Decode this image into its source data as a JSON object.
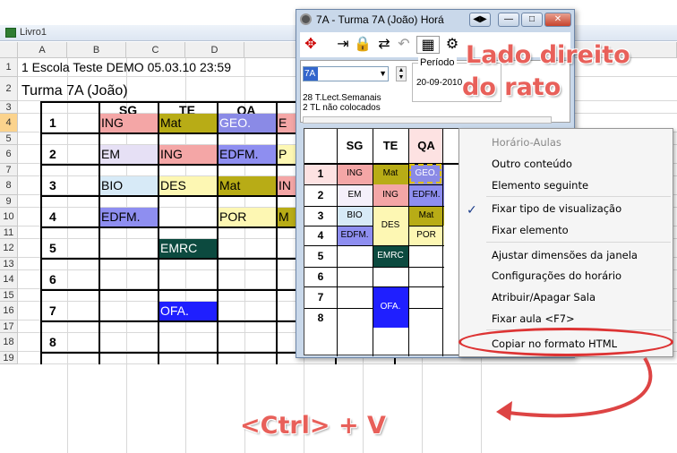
{
  "excel": {
    "doc_title": "Livro1",
    "columns": [
      "A",
      "B",
      "C",
      "D"
    ],
    "rows": [
      "1",
      "2",
      "3",
      "4",
      "5",
      "6",
      "7",
      "8",
      "9",
      "10",
      "11",
      "12",
      "13",
      "14",
      "15",
      "16",
      "17",
      "18",
      "19"
    ],
    "selected_row": "4",
    "title_text": "1 Escola Teste DEMO 05.03.10 23:59",
    "class_text": "Turma 7A (João)",
    "headers": [
      "SG",
      "TE",
      "QA"
    ],
    "periods": [
      "1",
      "2",
      "3",
      "4",
      "5",
      "6",
      "7",
      "8"
    ],
    "cells": {
      "r4": [
        "ING",
        "Mat",
        "GEO.",
        "E"
      ],
      "r6": [
        "EM",
        "ING",
        "EDFM.",
        "P"
      ],
      "r8": [
        "BIO",
        "DES",
        "Mat",
        "IN"
      ],
      "r10": [
        "EDFM.",
        "",
        "POR",
        "M"
      ],
      "r12": [
        "",
        "EMRC",
        "",
        ""
      ],
      "r16": [
        "",
        "OFA.",
        "",
        ""
      ]
    }
  },
  "window": {
    "title": "7A - Turma 7A (João)  Horá",
    "combo_value": "7A",
    "periodo_label": "Período",
    "periodo_value": "20-09-2010",
    "info1": "28  T.Lect.Semanais",
    "info2": "2  TL não colocados",
    "timetable": {
      "headers": [
        "SG",
        "TE",
        "QA"
      ],
      "periods": [
        "1",
        "2",
        "3",
        "4",
        "5",
        "6",
        "7",
        "8"
      ],
      "cells": [
        [
          "ING",
          "Mat",
          "GEO."
        ],
        [
          "EM",
          "ING",
          "EDFM."
        ],
        [
          "BIO",
          "DES",
          "Mat"
        ],
        [
          "EDFM.",
          "",
          "POR"
        ],
        [
          "",
          "EMRC",
          ""
        ],
        [
          "",
          "",
          ""
        ],
        [
          "",
          "OFA.",
          ""
        ],
        [
          "",
          "",
          ""
        ]
      ]
    }
  },
  "menu": {
    "items": [
      "Horário-Aulas",
      "Outro conteúdo",
      "Elemento seguinte",
      "Fixar tipo de visualização",
      "Fixar elemento",
      "Ajustar dimensões da janela",
      "Configurações do horário",
      "Atribuir/Apagar Sala",
      "Fixar aula <F7>",
      "Copiar no formato HTML"
    ]
  },
  "overlay": {
    "line1": "Lado direito",
    "line2": "do rato",
    "shortcut": "<Ctrl> + V"
  },
  "colors": {
    "pink": "#f4a6a6",
    "olive": "#b8ac16",
    "blue": "#8a8ae6",
    "lavender": "#e6e0f5",
    "lightblue": "#d7eaf7",
    "purple": "#8e8ef0",
    "yellow": "#fdf7b3",
    "darkteal": "#0c4a3f",
    "royal": "#1f1fff",
    "accent": "#e8605a"
  }
}
